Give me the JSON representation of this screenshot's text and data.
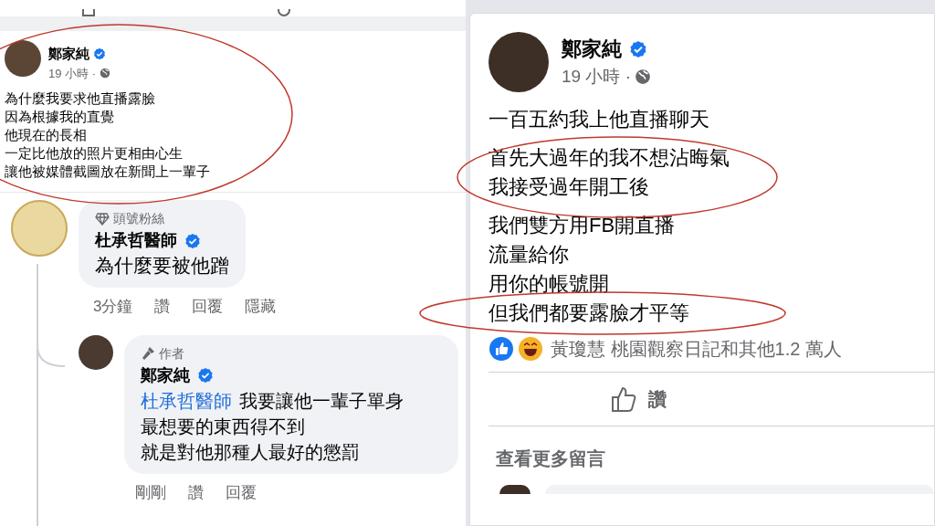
{
  "left_post": {
    "author": "鄭家純",
    "time": "19 小時 ·",
    "body_lines": [
      "為什麼我要求他直播露臉",
      "因為根據我的直覺",
      "他現在的長相",
      "一定比他放的照片更相由心生",
      "讓他被媒體截圖放在新聞上一輩子"
    ]
  },
  "comment": {
    "badge": "頭號粉絲",
    "author": "杜承哲醫師",
    "text": "為什麼要被他蹭",
    "actions": [
      "3分鐘",
      "讚",
      "回覆",
      "隱藏"
    ]
  },
  "reply": {
    "badge": "作者",
    "author": "鄭家純",
    "mention": "杜承哲醫師",
    "text_lines": [
      "我要讓他一輩子單身",
      "最想要的東西得不到",
      "就是對他那種人最好的懲罰"
    ],
    "actions": [
      "剛剛",
      "讚",
      "回覆"
    ]
  },
  "right_post": {
    "author": "鄭家純",
    "time": "19 小時 ·",
    "paragraphs": [
      [
        "一百五約我上他直播聊天"
      ],
      [
        "首先大過年的我不想沾晦氣",
        "我接受過年開工後"
      ],
      [
        "我們雙方用FB開直播",
        "流量給你",
        "用你的帳號開",
        "但我們都要露臉才平等"
      ]
    ],
    "reactions_text": "黃瓊慧 桃園觀察日記和其他1.2 萬人",
    "like_button": "讚",
    "more_comments": "查看更多留言"
  }
}
